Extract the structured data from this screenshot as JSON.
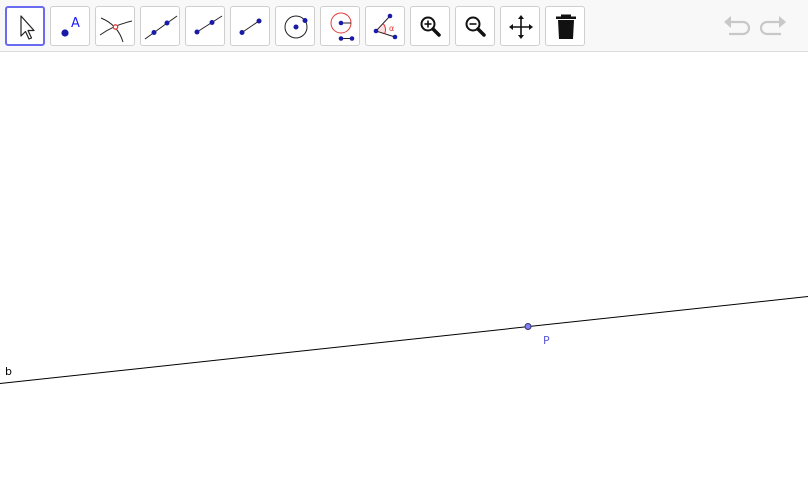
{
  "toolbar": {
    "tools": [
      {
        "name": "move-tool",
        "icon": "cursor-arrow-icon",
        "selected": true
      },
      {
        "name": "point-tool",
        "icon": "point-icon",
        "glyph": "A",
        "selected": false
      },
      {
        "name": "intersect-tool",
        "icon": "intersect-icon",
        "selected": false
      },
      {
        "name": "line-tool",
        "icon": "line-through-two-points-icon",
        "selected": false
      },
      {
        "name": "ray-tool",
        "icon": "ray-icon",
        "selected": false
      },
      {
        "name": "segment-tool",
        "icon": "segment-icon",
        "selected": false
      },
      {
        "name": "circle-tool",
        "icon": "circle-center-point-icon",
        "selected": false
      },
      {
        "name": "circle-radius-tool",
        "icon": "circle-center-radius-icon",
        "selected": false
      },
      {
        "name": "angle-tool",
        "icon": "angle-icon",
        "glyph": "α",
        "selected": false
      },
      {
        "name": "zoom-in-tool",
        "icon": "zoom-in-icon",
        "selected": false
      },
      {
        "name": "zoom-out-tool",
        "icon": "zoom-out-icon",
        "selected": false
      },
      {
        "name": "move-view-tool",
        "icon": "move-graphics-view-icon",
        "selected": false
      },
      {
        "name": "delete-tool",
        "icon": "trash-icon",
        "selected": false
      }
    ],
    "undo_icon": "undo-icon",
    "redo_icon": "redo-icon"
  },
  "graphics": {
    "objects": [
      {
        "type": "line",
        "label": "b",
        "through_point": "P"
      },
      {
        "type": "point",
        "label": "P"
      }
    ],
    "colors": {
      "line": "#000000",
      "point_fill": "#8080ff",
      "point_stroke": "#333366",
      "point_label": "#5a5adc",
      "selection": "#6b6bf2",
      "tool_blue": "#1a1aff",
      "tool_red": "#e53935"
    }
  }
}
